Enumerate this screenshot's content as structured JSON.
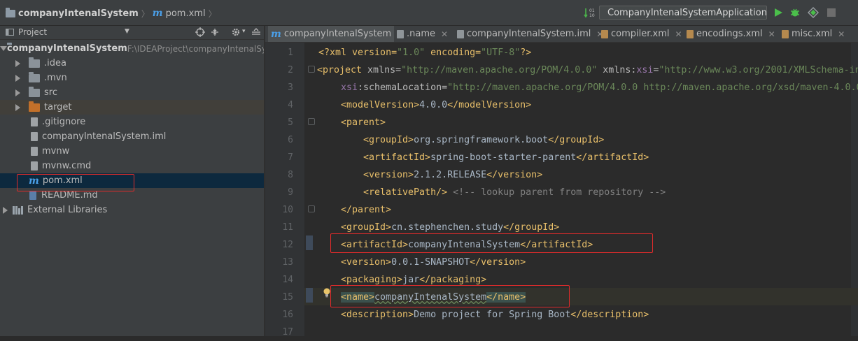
{
  "navbar": {
    "project_name": "companyIntenalSystem",
    "file_name": "pom.xml",
    "run_config": "CompanyIntenalSystemApplication",
    "icons": [
      "folder-icon",
      "maven-icon",
      "sort-icon",
      "spring-boot-icon",
      "run-icon",
      "debug-icon",
      "coverage-icon",
      "stop-icon"
    ]
  },
  "project_panel": {
    "title": "Project",
    "root": {
      "name": "companyIntenalSystem",
      "path": "F:\\IDEAProject\\companyIntenalSy"
    },
    "items": [
      {
        "label": ".idea",
        "type": "folder"
      },
      {
        "label": ".mvn",
        "type": "folder"
      },
      {
        "label": "src",
        "type": "folder"
      },
      {
        "label": "target",
        "type": "folder-orange"
      },
      {
        "label": ".gitignore",
        "type": "file"
      },
      {
        "label": "companyIntenalSystem.iml",
        "type": "file"
      },
      {
        "label": "mvnw",
        "type": "file"
      },
      {
        "label": "mvnw.cmd",
        "type": "file"
      },
      {
        "label": "pom.xml",
        "type": "maven",
        "selected": true
      },
      {
        "label": "README.md",
        "type": "md"
      }
    ],
    "external_libraries": "External Libraries"
  },
  "tabs": [
    {
      "label": "companyIntenalSystem",
      "active": true,
      "icon": "maven-icon"
    },
    {
      "label": ".name",
      "icon": "file-icon"
    },
    {
      "label": "companyIntenalSystem.iml",
      "icon": "file-icon"
    },
    {
      "label": "compiler.xml",
      "icon": "xml-icon"
    },
    {
      "label": "encodings.xml",
      "icon": "xml-icon"
    },
    {
      "label": "misc.xml",
      "icon": "xml-icon"
    }
  ],
  "code_lines": [
    {
      "n": "1"
    },
    {
      "n": "2"
    },
    {
      "n": "3"
    },
    {
      "n": "4"
    },
    {
      "n": "5"
    },
    {
      "n": "6"
    },
    {
      "n": "7"
    },
    {
      "n": "8"
    },
    {
      "n": "9"
    },
    {
      "n": "10"
    },
    {
      "n": "11"
    },
    {
      "n": "12"
    },
    {
      "n": "13"
    },
    {
      "n": "14"
    },
    {
      "n": "15"
    },
    {
      "n": "16"
    },
    {
      "n": "17"
    }
  ],
  "code": {
    "l1_a": "<?xml version=",
    "l1_v1": "\"1.0\"",
    "l1_b": " encoding=",
    "l1_v2": "\"UTF-8\"",
    "l1_c": "?>",
    "l2_tag": "<project",
    "l2_attr1": " xmlns=",
    "l2_val1": "\"http://maven.apache.org/POM/4.0.0\"",
    "l2_attr2": " xmlns:",
    "l2_ns": "xsi",
    "l2_eq": "=",
    "l2_val2": "\"http://www.w3.org/2001/XMLSchema-in",
    "l3_ns": "xsi",
    "l3_attr": ":schemaLocation=",
    "l3_val": "\"http://maven.apache.org/POM/4.0.0 http://maven.apache.org/xsd/maven-4.0.0",
    "l4_open": "<modelVersion>",
    "l4_text": "4.0.0",
    "l4_close": "</modelVersion>",
    "l5_open": "<parent>",
    "l6_open": "<groupId>",
    "l6_text": "org.springframework.boot",
    "l6_close": "</groupId>",
    "l7_open": "<artifactId>",
    "l7_text": "spring-boot-starter-parent",
    "l7_close": "</artifactId>",
    "l8_open": "<version>",
    "l8_text": "2.1.2.RELEASE",
    "l8_close": "</version>",
    "l9_open": "<relativePath/>",
    "l9_comment": " <!-- lookup parent from repository -->",
    "l10_close": "</parent>",
    "l11_open": "<groupId>",
    "l11_text": "cn.stephenchen.study",
    "l11_close": "</groupId>",
    "l12_open": "<artifactId>",
    "l12_text": "companyIntenalSystem",
    "l12_close": "</artifactId>",
    "l13_open": "<version>",
    "l13_text": "0.0.1-SNAPSHOT",
    "l13_close": "</version>",
    "l14_open": "<packaging>",
    "l14_text": "jar",
    "l14_close": "</packaging>",
    "l15_open": "<name>",
    "l15_text": "companyIntenalSystem",
    "l15_close": "</name>",
    "l16_open": "<description>",
    "l16_text": "Demo project for Spring Boot",
    "l16_close": "</description>"
  },
  "colors": {
    "bg": "#2b2b2b",
    "panel": "#3c3f41",
    "tag": "#e8bf6a",
    "string": "#6a8759",
    "namespace": "#9876aa",
    "comment": "#808080",
    "annotation": "#e02b2b",
    "selection": "#0d293e"
  }
}
